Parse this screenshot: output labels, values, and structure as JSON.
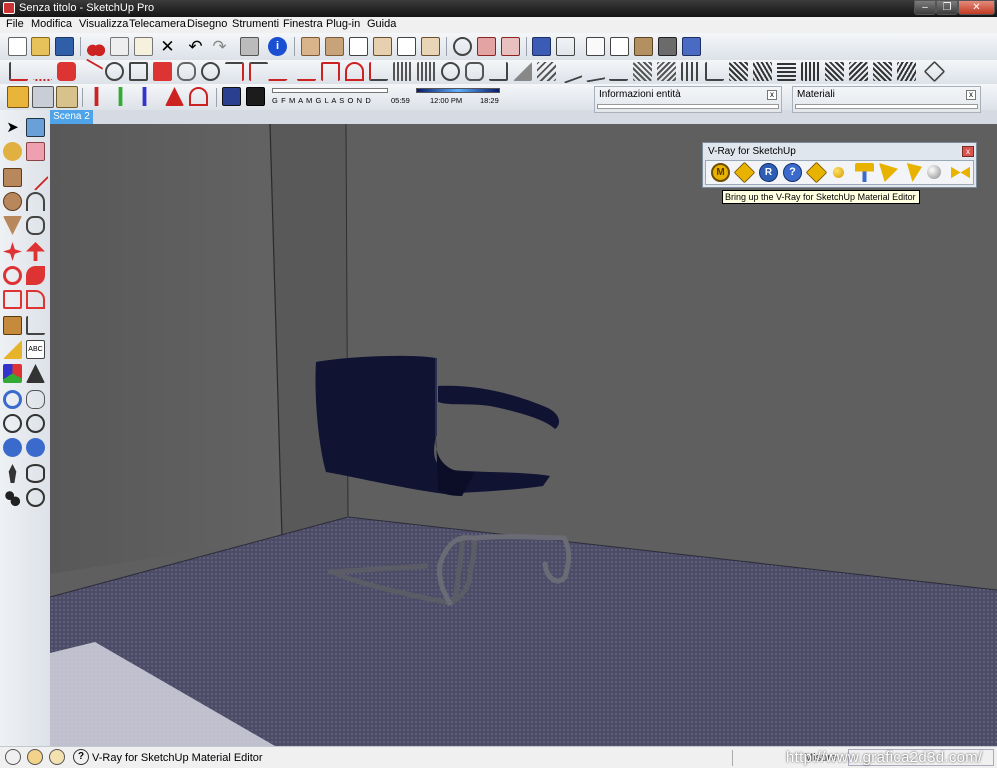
{
  "window": {
    "title": "Senza titolo - SketchUp Pro",
    "minimize": "–",
    "maximize": "❐",
    "close": "✕"
  },
  "menu": [
    "File",
    "Modifica",
    "Visualizza",
    "Telecamera",
    "Disegno",
    "Strumenti",
    "Finestra",
    "Plug-in",
    "Guida"
  ],
  "toolbars": {
    "months": "G F M A M G L A S O N D",
    "time_start": "05:59",
    "time_mid": "12:00 PM",
    "time_end": "18:29"
  },
  "scene_tab": "Scena 2",
  "trays": {
    "entity_info": "Informazioni entità",
    "materials": "Materiali",
    "close": "x"
  },
  "vray": {
    "title": "V-Ray for SketchUp",
    "close": "x",
    "tooltip": "Bring up the V-Ray for SketchUp Material Editor"
  },
  "status": {
    "text": "V-Ray for SketchUp Material Editor",
    "measure": "Misure"
  },
  "watermark": "http://www.grafica2d3d.com/",
  "colors": {
    "wall": "#5e5e5e",
    "floor": "#4f4f6a",
    "chair": "#101332",
    "vray_accent": "#e8b200",
    "scene_tab": "#4fa3e8"
  }
}
